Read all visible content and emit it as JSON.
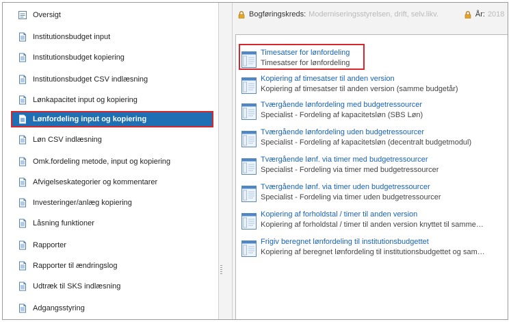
{
  "nav": {
    "items": [
      {
        "label": "Oversigt",
        "icon": "overview-icon",
        "active": false
      },
      {
        "label": "Institutionsbudget input",
        "icon": "document-icon",
        "active": false
      },
      {
        "label": "Institutionsbudget kopiering",
        "icon": "document-icon",
        "active": false
      },
      {
        "label": "Institutionsbudget CSV indlæsning",
        "icon": "document-icon",
        "active": false
      },
      {
        "label": "Lønkapacitet input og kopiering",
        "icon": "document-icon",
        "active": false
      },
      {
        "label": "Lønfordeling input og kopiering",
        "icon": "document-icon",
        "active": true
      },
      {
        "label": "Løn CSV indlæsning",
        "icon": "document-icon",
        "active": false
      },
      {
        "label": "Omk.fordeling metode, input og kopiering",
        "icon": "document-icon",
        "active": false
      },
      {
        "label": "Afvigelseskategorier og kommentarer",
        "icon": "document-icon",
        "active": false
      },
      {
        "label": "Investeringer/anlæg kopiering",
        "icon": "document-icon",
        "active": false
      },
      {
        "label": "Låsning funktioner",
        "icon": "document-icon",
        "active": false
      },
      {
        "label": "Rapporter",
        "icon": "document-icon",
        "active": false
      },
      {
        "label": "Rapporter til ændringslog",
        "icon": "document-icon",
        "active": false
      },
      {
        "label": "Udtræk til SKS indlæsning",
        "icon": "document-icon",
        "active": false
      },
      {
        "label": "Adgangsstyring",
        "icon": "document-icon",
        "active": false
      }
    ]
  },
  "topbar": {
    "bogforingskreds_label": "Bogføringskreds:",
    "bogforingskreds_value": "Moderniseringsstyrelsen, drift, selv.likv.",
    "aar_label": "År:",
    "aar_value": "2018"
  },
  "entries": [
    {
      "title": "Timesatser for lønfordeling",
      "desc": "Timesatser for lønfordeling"
    },
    {
      "title": "Kopiering af timesatser til anden version",
      "desc": "Kopiering af timesatser til anden version (samme budgetår)"
    },
    {
      "title": "Tværgående lønfordeling med budgetressourcer",
      "desc": "Specialist - Fordeling af kapacitetsløn (SBS Løn)"
    },
    {
      "title": "Tværgående lønfordeling uden budgetressourcer",
      "desc": "Specialist - Fordeling af kapacitetsløn (decentralt budgetmodul)"
    },
    {
      "title": "Tværgående lønf. via timer med budgetressourcer",
      "desc": "Specialist - Fordeling via timer med budgetressourcer"
    },
    {
      "title": "Tværgående lønf. via timer uden budgetressourcer",
      "desc": "Specialist - Fordeling via timer uden budgetressourcer"
    },
    {
      "title": "Kopiering af forholdstal / timer til anden version",
      "desc": "Kopiering af forholdstal / timer til anden version knyttet til samme…"
    },
    {
      "title": "Frigiv beregnet lønfordeling til institutionsbudgettet",
      "desc": "Kopiering af beregnet lønfordeling til institutionsbudgettet og sam…"
    }
  ],
  "colors": {
    "accent": "#1e6fb3",
    "highlight_border": "#d8262b",
    "link": "#1a62b5",
    "lock": "#e0a52b"
  }
}
